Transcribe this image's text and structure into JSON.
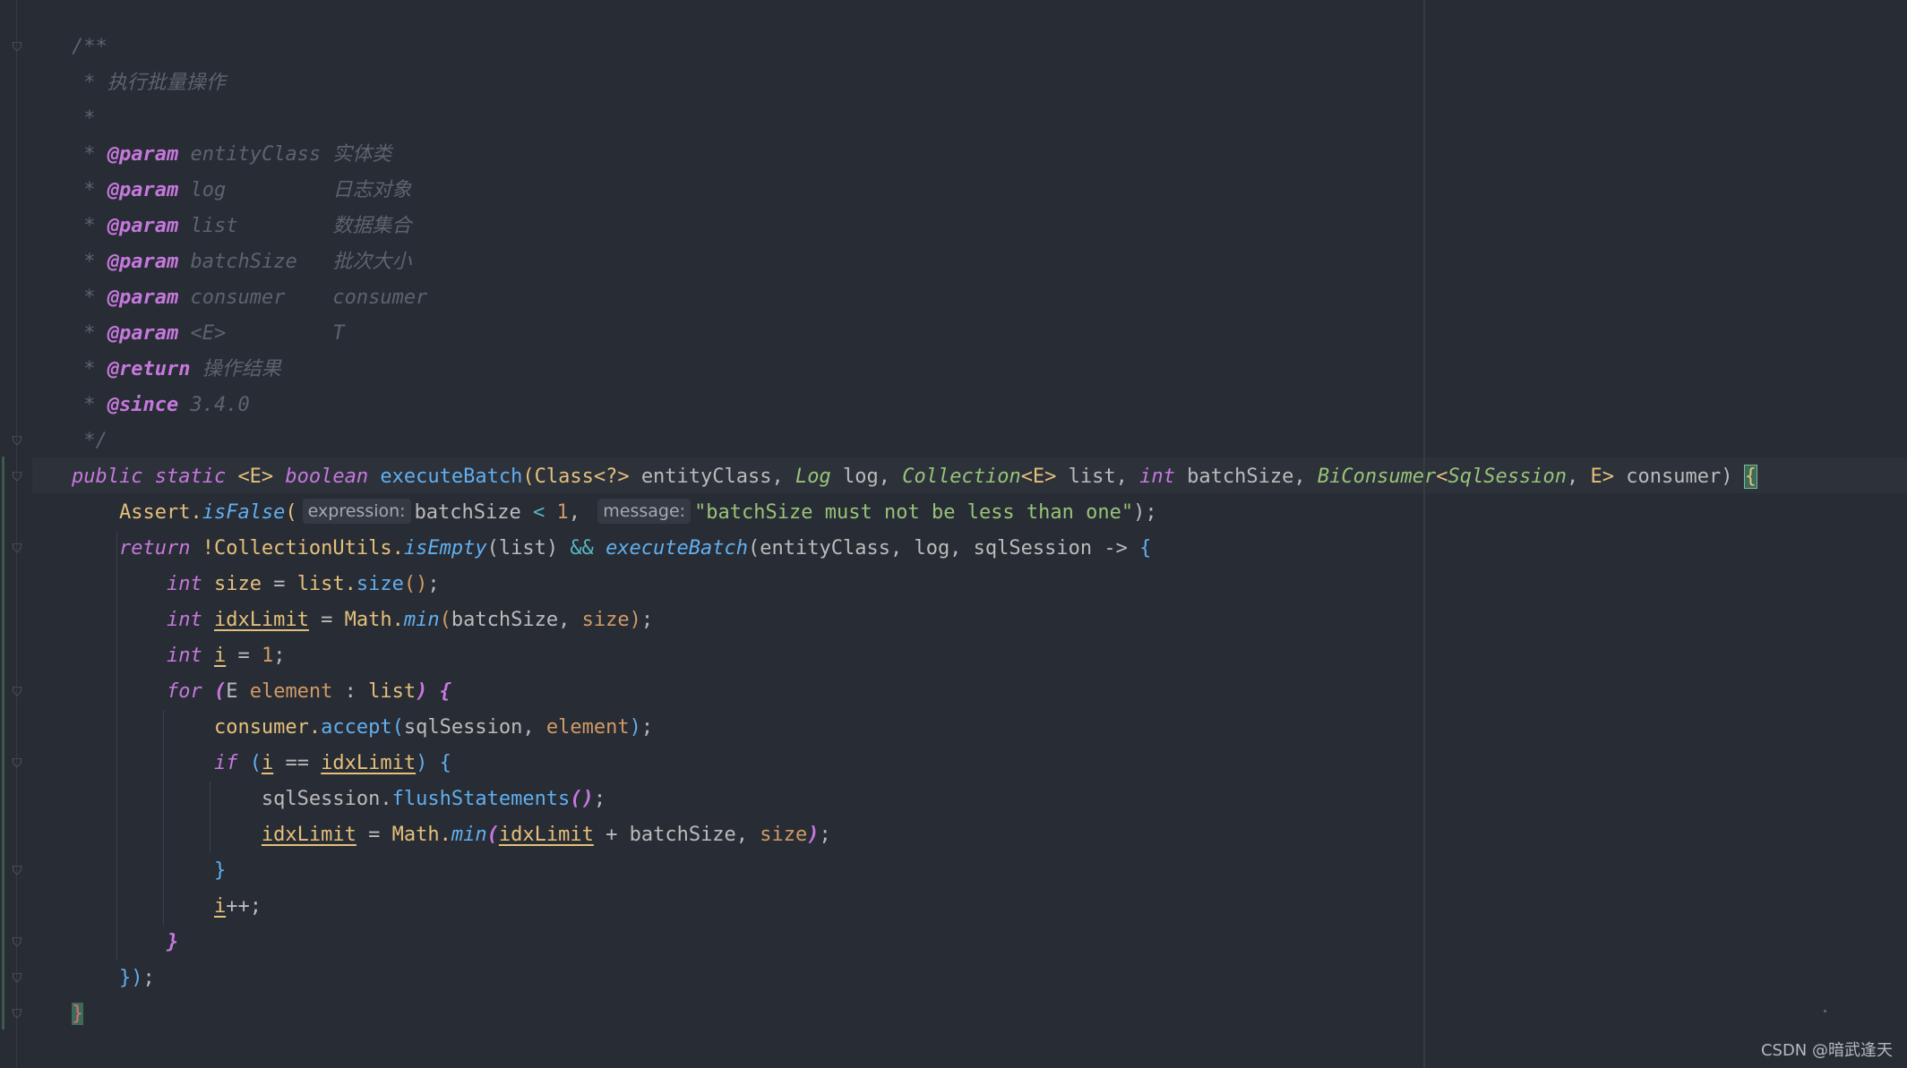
{
  "editor": {
    "lines": [
      [
        {
          "t": "/**",
          "c": "cm"
        }
      ],
      [
        {
          "t": " * 执行批量操作",
          "c": "cm"
        }
      ],
      [
        {
          "t": " *",
          "c": "cm"
        }
      ],
      [
        {
          "t": " * ",
          "c": "cm"
        },
        {
          "t": "@param",
          "c": "tag"
        },
        {
          "t": " entityClass ",
          "c": "cm"
        },
        {
          "t": "实体类",
          "c": "cm"
        }
      ],
      [
        {
          "t": " * ",
          "c": "cm"
        },
        {
          "t": "@param",
          "c": "tag"
        },
        {
          "t": " log         ",
          "c": "cm"
        },
        {
          "t": "日志对象",
          "c": "cm"
        }
      ],
      [
        {
          "t": " * ",
          "c": "cm"
        },
        {
          "t": "@param",
          "c": "tag"
        },
        {
          "t": " list        ",
          "c": "cm"
        },
        {
          "t": "数据集合",
          "c": "cm"
        }
      ],
      [
        {
          "t": " * ",
          "c": "cm"
        },
        {
          "t": "@param",
          "c": "tag"
        },
        {
          "t": " batchSize   ",
          "c": "cm"
        },
        {
          "t": "批次大小",
          "c": "cm"
        }
      ],
      [
        {
          "t": " * ",
          "c": "cm"
        },
        {
          "t": "@param",
          "c": "tag"
        },
        {
          "t": " consumer    ",
          "c": "cm"
        },
        {
          "t": "consumer",
          "c": "cm"
        }
      ],
      [
        {
          "t": " * ",
          "c": "cm"
        },
        {
          "t": "@param",
          "c": "tag"
        },
        {
          "t": " <E>         ",
          "c": "cm"
        },
        {
          "t": "T",
          "c": "cm"
        }
      ],
      [
        {
          "t": " * ",
          "c": "cm"
        },
        {
          "t": "@return",
          "c": "tag"
        },
        {
          "t": " 操作结果",
          "c": "cm"
        }
      ],
      [
        {
          "t": " * ",
          "c": "cm"
        },
        {
          "t": "@since",
          "c": "tag"
        },
        {
          "t": " 3.4.0",
          "c": "cm"
        }
      ],
      [
        {
          "t": " */",
          "c": "cm"
        }
      ],
      [
        {
          "t": "public static ",
          "c": "kw"
        },
        {
          "t": "<E> ",
          "c": "ty"
        },
        {
          "t": "boolean ",
          "c": "kw"
        },
        {
          "t": "executeBatch",
          "c": "fn"
        },
        {
          "t": "(",
          "c": "ty"
        },
        {
          "t": "Class",
          "c": "ty"
        },
        {
          "t": "<?> ",
          "c": "ty"
        },
        {
          "t": "entityClass, "
        },
        {
          "t": "Log",
          "c": "ity"
        },
        {
          "t": " log, "
        },
        {
          "t": "Collection",
          "c": "ity"
        },
        {
          "t": "<E> ",
          "c": "ty"
        },
        {
          "t": "list, "
        },
        {
          "t": "int ",
          "c": "kw"
        },
        {
          "t": "batchSize, "
        },
        {
          "t": "BiConsumer",
          "c": "ity"
        },
        {
          "t": "<",
          "c": "ty"
        },
        {
          "t": "SqlSession",
          "c": "ity"
        },
        {
          "t": ", "
        },
        {
          "t": "E",
          "c": "ty"
        },
        {
          "t": "> ",
          "c": "ty"
        },
        {
          "t": "consumer) "
        },
        {
          "t": "{",
          "c": "brace-match"
        }
      ],
      [
        {
          "t": "    Assert.",
          "c": "ty"
        },
        {
          "t": "isFalse",
          "c": "fni"
        },
        {
          "t": "(",
          "c": "ty"
        },
        {
          "t": "expression:",
          "c": "hint"
        },
        {
          "t": "batchSize "
        },
        {
          "t": "< ",
          "c": "op"
        },
        {
          "t": "1",
          "c": "num"
        },
        {
          "t": ", "
        },
        {
          "t": "message:",
          "c": "hint"
        },
        {
          "t": "\"batchSize must not be less than one\"",
          "c": "str"
        },
        {
          "t": ");"
        }
      ],
      [
        {
          "t": "    "
        },
        {
          "t": "return ",
          "c": "kw"
        },
        {
          "t": "!CollectionUtils.",
          "c": "ty"
        },
        {
          "t": "isEmpty",
          "c": "fni"
        },
        {
          "t": "(list) "
        },
        {
          "t": "&& ",
          "c": "op"
        },
        {
          "t": "executeBatch",
          "c": "fni"
        },
        {
          "t": "(entityClass, log, sqlSession "
        },
        {
          "t": "-> "
        },
        {
          "t": "{",
          "c": "fn"
        }
      ],
      [
        {
          "t": "        "
        },
        {
          "t": "int ",
          "c": "kw"
        },
        {
          "t": "size ",
          "c": "var"
        },
        {
          "t": "= "
        },
        {
          "t": "list.",
          "c": "var"
        },
        {
          "t": "size",
          "c": "fn"
        },
        {
          "t": "()",
          "c": "num"
        },
        {
          "t": ";"
        }
      ],
      [
        {
          "t": "        "
        },
        {
          "t": "int ",
          "c": "kw"
        },
        {
          "t": "idxLimit",
          "c": "mut"
        },
        {
          "t": " = "
        },
        {
          "t": "Math.",
          "c": "ty"
        },
        {
          "t": "min",
          "c": "fni"
        },
        {
          "t": "(",
          "c": "num"
        },
        {
          "t": "batchSize, "
        },
        {
          "t": "size",
          "c": "loc"
        },
        {
          "t": ")",
          "c": "num"
        },
        {
          "t": ";"
        }
      ],
      [
        {
          "t": "        "
        },
        {
          "t": "int ",
          "c": "kw"
        },
        {
          "t": "i",
          "c": "mut"
        },
        {
          "t": " = "
        },
        {
          "t": "1",
          "c": "num"
        },
        {
          "t": ";"
        }
      ],
      [
        {
          "t": "        "
        },
        {
          "t": "for ",
          "c": "kw"
        },
        {
          "t": "(",
          "c": "tag"
        },
        {
          "t": "E "
        },
        {
          "t": "element ",
          "c": "loc"
        },
        {
          "t": ": "
        },
        {
          "t": "list",
          "c": "var"
        },
        {
          "t": ") ",
          "c": "tag"
        },
        {
          "t": "{",
          "c": "tag"
        }
      ],
      [
        {
          "t": "            "
        },
        {
          "t": "consumer.",
          "c": "var"
        },
        {
          "t": "accept",
          "c": "fn"
        },
        {
          "t": "(",
          "c": "fn"
        },
        {
          "t": "sqlSession, "
        },
        {
          "t": "element",
          "c": "loc"
        },
        {
          "t": ")",
          "c": "fn"
        },
        {
          "t": ";"
        }
      ],
      [
        {
          "t": "            "
        },
        {
          "t": "if ",
          "c": "kw"
        },
        {
          "t": "(",
          "c": "fn"
        },
        {
          "t": "i",
          "c": "mut"
        },
        {
          "t": " == "
        },
        {
          "t": "idxLimit",
          "c": "mut"
        },
        {
          "t": ") ",
          "c": "fn"
        },
        {
          "t": "{",
          "c": "fn"
        }
      ],
      [
        {
          "t": "                "
        },
        {
          "t": "sqlSession.",
          "c": ""
        },
        {
          "t": "flushStatements",
          "c": "fn"
        },
        {
          "t": "()",
          "c": "tag"
        },
        {
          "t": ";"
        }
      ],
      [
        {
          "t": "                "
        },
        {
          "t": "idxLimit",
          "c": "mut"
        },
        {
          "t": " = "
        },
        {
          "t": "Math.",
          "c": "ty"
        },
        {
          "t": "min",
          "c": "fni"
        },
        {
          "t": "(",
          "c": "tag"
        },
        {
          "t": "idxLimit",
          "c": "mut"
        },
        {
          "t": " + "
        },
        {
          "t": "batchSize, "
        },
        {
          "t": "size",
          "c": "loc"
        },
        {
          "t": ")",
          "c": "tag"
        },
        {
          "t": ";"
        }
      ],
      [
        {
          "t": "            "
        },
        {
          "t": "}",
          "c": "fn"
        }
      ],
      [
        {
          "t": "            "
        },
        {
          "t": "i",
          "c": "mut"
        },
        {
          "t": "++;"
        }
      ],
      [
        {
          "t": "        "
        },
        {
          "t": "}",
          "c": "tag"
        }
      ],
      [
        {
          "t": "    "
        },
        {
          "t": "})",
          "c": "fn"
        },
        {
          "t": ";"
        }
      ],
      [
        {
          "t": "}",
          "c": "brace-close"
        }
      ]
    ]
  },
  "colors": {
    "background": "#282c34",
    "comment": "#5c6370",
    "keyword": "#c678dd",
    "function": "#61afef",
    "type": "#e5c07b",
    "string": "#98c379",
    "number": "#d19a66"
  },
  "watermark": "CSDN @暗武逢天"
}
